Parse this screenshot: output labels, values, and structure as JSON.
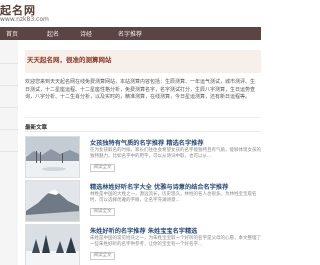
{
  "header": {
    "logo_title": "起名网",
    "logo_url": "www.nzk83.com"
  },
  "nav": {
    "items": [
      "首页",
      "起名",
      "诗经",
      "名字推荐"
    ]
  },
  "welcome": {
    "text": "天天起名网，很准的测算网站",
    "intro": "欢迎您来到天天起名网在线免费测算网站，本站测算内容包括：生辰测算、一年运气测试，城市测评、生日测试，十二星座运程、十二星座性格分析，免费测算名字，名字测试打分，生辰八字测算，生日运势查询，八字分析、十二生肖分析，以及实时的，精准测算，在线测算，今日星运测算，还有新日运程等。"
  },
  "section": {
    "title": "最新文章"
  },
  "articles": [
    {
      "title": "女孩独特有气质的名字推荐 精选名字推荐",
      "summary": "在为女孩取名的时候，家长们往往会希望女孩的名字能独特且有气质，能够体现女孩的独特魅力，比如名字中的用字，可以从诗词中取，也可以从...",
      "button": "阅读全文"
    },
    {
      "title": "精选林姓好听名字大全 优雅与诗意的结合名字推荐",
      "summary": "林姓是中国的大姓之一，源远流长，历史悠久，林姓的名人也很多。为林姓宝宝取名时，可以选择优雅的字眼，让名字充满诗意...",
      "button": "阅读全文"
    },
    {
      "title": "朱姓好听的名字推荐 朱姓宝宝名字精选",
      "summary": "朱姓是中国的常见姓氏之一，为朱姓宝宝取一个好听的名字是父母的心愿，本文整理了一些朱姓好听的名字供参考，让你的宝宝有一个好名字...",
      "button": "阅读全文"
    }
  ]
}
